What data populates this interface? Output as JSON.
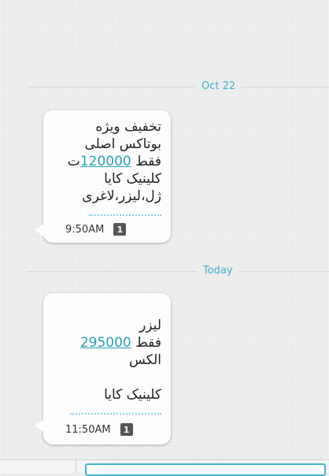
{
  "dates": [
    "Oct 22",
    "Today"
  ],
  "messages": [
    {
      "lines": [
        "تخفیف ویژه",
        "بوتاکس اصلی",
        "فقط ",
        "ت",
        "کلینیک کایا",
        "ژل،لیزر،لاغری"
      ],
      "price": "120000",
      "time": "9:50AM",
      "sim": "1"
    },
    {
      "lines": [
        "لیزر",
        "فقط ",
        "الکس",
        "",
        "کلینیک کایا"
      ],
      "price": "295000",
      "time": "11:50AM",
      "sim": "1"
    }
  ],
  "colors": {
    "accent": "#3fb0cc",
    "link": "#2a9fbd",
    "bubble": "#fdfdfd",
    "background": "#ececec"
  }
}
